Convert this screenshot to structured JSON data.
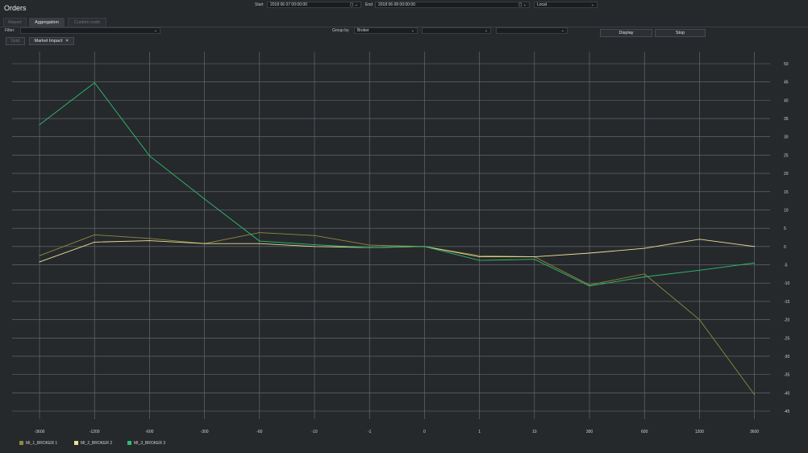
{
  "app": {
    "title": "Orders"
  },
  "header": {
    "start_label": "Start",
    "start_value": "2018 06 07 00:00:00",
    "end_label": "End",
    "end_value": "2018 06 08 00:00:00",
    "timezone": "Local"
  },
  "tabs": [
    {
      "label": "Report",
      "active": false
    },
    {
      "label": "Aggregation",
      "active": true
    },
    {
      "label": "Custom code",
      "active": false
    }
  ],
  "filter": {
    "label": "Filter:",
    "value": ""
  },
  "group_by": {
    "label": "Group by",
    "value": "Broker",
    "second": "",
    "third": ""
  },
  "buttons": {
    "display": "Display",
    "stop": "Stop",
    "grid": "Grid",
    "market_impact": "Market Impact"
  },
  "colors": {
    "series1": "#8f8a3c",
    "series2": "#eddf97",
    "series3": "#2ebc70",
    "background": "#26292c",
    "grid": "#6c7175"
  },
  "chart_data": {
    "type": "line",
    "categories": [
      "-3600",
      "-1200",
      "-600",
      "-300",
      "-60",
      "-10",
      "-1",
      "0",
      "1",
      "10",
      "300",
      "600",
      "1200",
      "3600"
    ],
    "ylim": [
      -45,
      50
    ],
    "yticks": [
      50,
      45,
      40,
      35,
      30,
      25,
      20,
      15,
      10,
      5,
      0,
      -5,
      -10,
      -15,
      -20,
      -25,
      -30,
      -35,
      -40,
      -45
    ],
    "grid": true,
    "legend_position": "bottom-left",
    "series": [
      {
        "name": "MI_1_BROKER 1",
        "values": [
          -2.5,
          3.2,
          2.2,
          0.8,
          3.8,
          3.0,
          0.4,
          0,
          -2.5,
          -2.8,
          -10.5,
          -7.5,
          -20,
          -40.5
        ]
      },
      {
        "name": "MI_2_BROKER 2",
        "values": [
          -4.2,
          1.2,
          1.6,
          0.8,
          0.8,
          0.0,
          -0.3,
          0,
          -2.8,
          -2.8,
          -1.8,
          -0.5,
          2.0,
          0.0
        ]
      },
      {
        "name": "MI_3_BROKER 3",
        "values": [
          33.3,
          44.8,
          24.8,
          13.0,
          1.5,
          0.5,
          -0.3,
          0,
          -3.8,
          -3.5,
          -10.8,
          -8.3,
          -6.5,
          -4.5
        ]
      }
    ]
  }
}
